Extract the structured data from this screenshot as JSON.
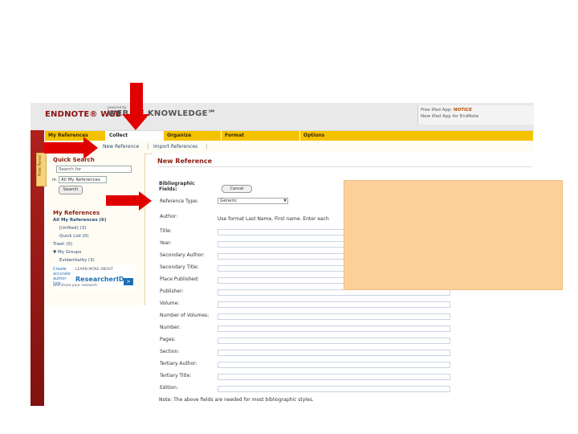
{
  "app": {
    "logo_endnote": "ENDNOTE® WEB",
    "logo_powered": "powered by",
    "logo_wok": "WEB OF KNOWLEDGE℠",
    "notice_prefix": "Free iPad App: ",
    "notice_highlight": "NOTICE",
    "notice_line2": "New iPad App for EndNote"
  },
  "tabs": [
    {
      "label": "My References"
    },
    {
      "label": "Collect"
    },
    {
      "label": "Organize"
    },
    {
      "label": "Format"
    },
    {
      "label": "Options"
    }
  ],
  "subnav": {
    "new_reference": "New Reference",
    "separator": "|",
    "import_references": "Import References"
  },
  "hide_panel": "Hide Panel",
  "quick_search": {
    "heading": "Quick Search",
    "placeholder": "Search for",
    "in_label": "in",
    "select_value": "All My References",
    "button": "Search"
  },
  "my_references": {
    "heading": "My References",
    "all": "All My References (6)",
    "unfiled": "[Unfiled] (3)",
    "quick_list": "Quick List (0)",
    "trash": "Trash (0)",
    "my_groups": "▼ My Groups",
    "group1": "Evidentiality (3)"
  },
  "researcher": {
    "create": "Create accurate author lists",
    "learn_more": "LEARN MORE ABOUT",
    "brand": "ResearcherID",
    "arrow": ">",
    "sub": "and share your research"
  },
  "form": {
    "title": "New Reference",
    "bibliographic": "Bibliographic Fields:",
    "cancel": "Cancel",
    "ref_type_label": "Reference Type:",
    "ref_type_value": "Generic",
    "author_label": "Author:",
    "author_hint": "Use format Last Name, First name. Enter each",
    "fields": [
      "Title:",
      "Year:",
      "Secondary Author:",
      "Secondary Title:",
      "Place Published:",
      "Publisher:",
      "Volume:",
      "Number of Volumes:",
      "Number:",
      "Pages:",
      "Section:",
      "Tertiary Author:",
      "Tertiary Title:",
      "Edition:"
    ],
    "note": "Note: The above fields are needed for most bibliographic styles."
  },
  "colors": {
    "arrow": "#e10000",
    "overlay": "#fdd09a",
    "tab_yellow": "#f5c200",
    "brand_red": "#8a1d12"
  }
}
